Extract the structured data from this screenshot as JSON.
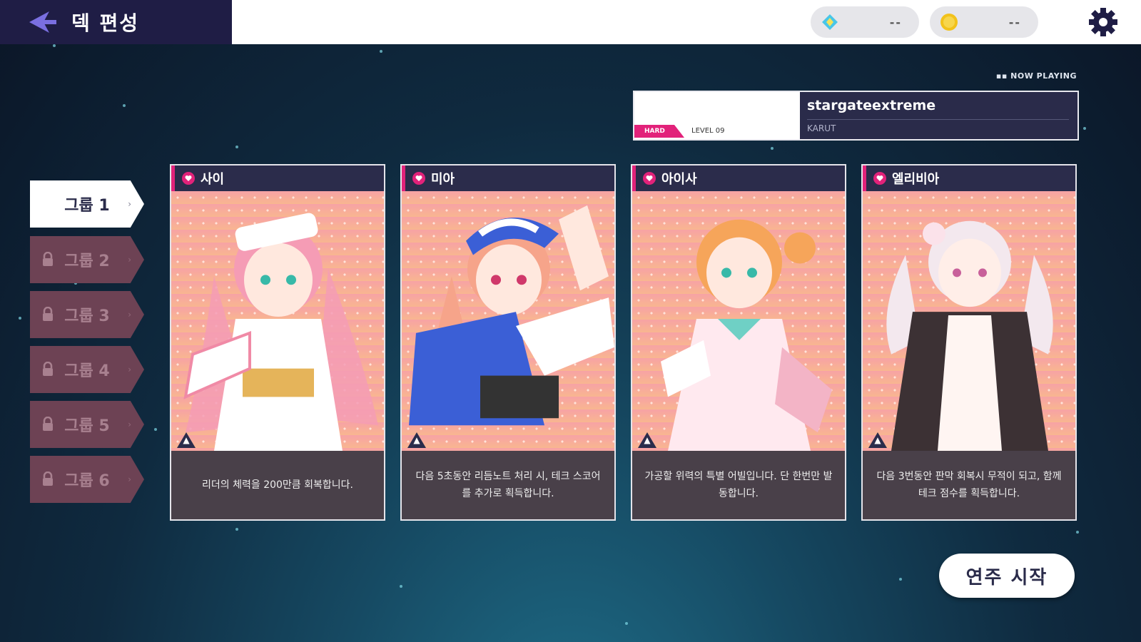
{
  "header": {
    "title": "덱 편성",
    "back_icon": "back-arrow-icon",
    "currencies": [
      {
        "icon": "diamond-gem-icon",
        "value": "--"
      },
      {
        "icon": "gold-coin-icon",
        "value": "--"
      }
    ],
    "settings_icon": "gear-icon"
  },
  "now_playing": {
    "label": "NOW PLAYING",
    "difficulty": "HARD",
    "level": "LEVEL 09",
    "song_title": "stargateextreme",
    "artist": "KARUT"
  },
  "groups": [
    {
      "label": "그룹 1",
      "locked": false,
      "active": true
    },
    {
      "label": "그룹 2",
      "locked": true,
      "active": false
    },
    {
      "label": "그룹 3",
      "locked": true,
      "active": false
    },
    {
      "label": "그룹 4",
      "locked": true,
      "active": false
    },
    {
      "label": "그룹 5",
      "locked": true,
      "active": false
    },
    {
      "label": "그룹 6",
      "locked": true,
      "active": false
    }
  ],
  "cards": [
    {
      "name": "사이",
      "description": "리더의 체력을 200만큼 회복합니다.",
      "hair": "#f59cb5",
      "outfit": "#ffffff"
    },
    {
      "name": "미아",
      "description": "다음 5초동안 리듬노트 처리 시, 테크 스코어를 추가로 획득합니다.",
      "hair": "#f6a48a",
      "outfit": "#3b5fd6"
    },
    {
      "name": "아이사",
      "description": "가공할 위력의 특별 어빌입니다. 단 한번만 발동합니다.",
      "hair": "#f6a55a",
      "outfit": "#ffe9ef"
    },
    {
      "name": "엘리비아",
      "description": "다음 3번동안 판막 회복시 무적이 되고, 함께 테크 점수를 획득합니다.",
      "hair": "#f3e8ee",
      "outfit": "#3c3134"
    }
  ],
  "start_button": "연주 시작",
  "colors": {
    "accent": "#e2227a",
    "navy": "#1f1d45",
    "card_head": "#2b2c4b"
  }
}
